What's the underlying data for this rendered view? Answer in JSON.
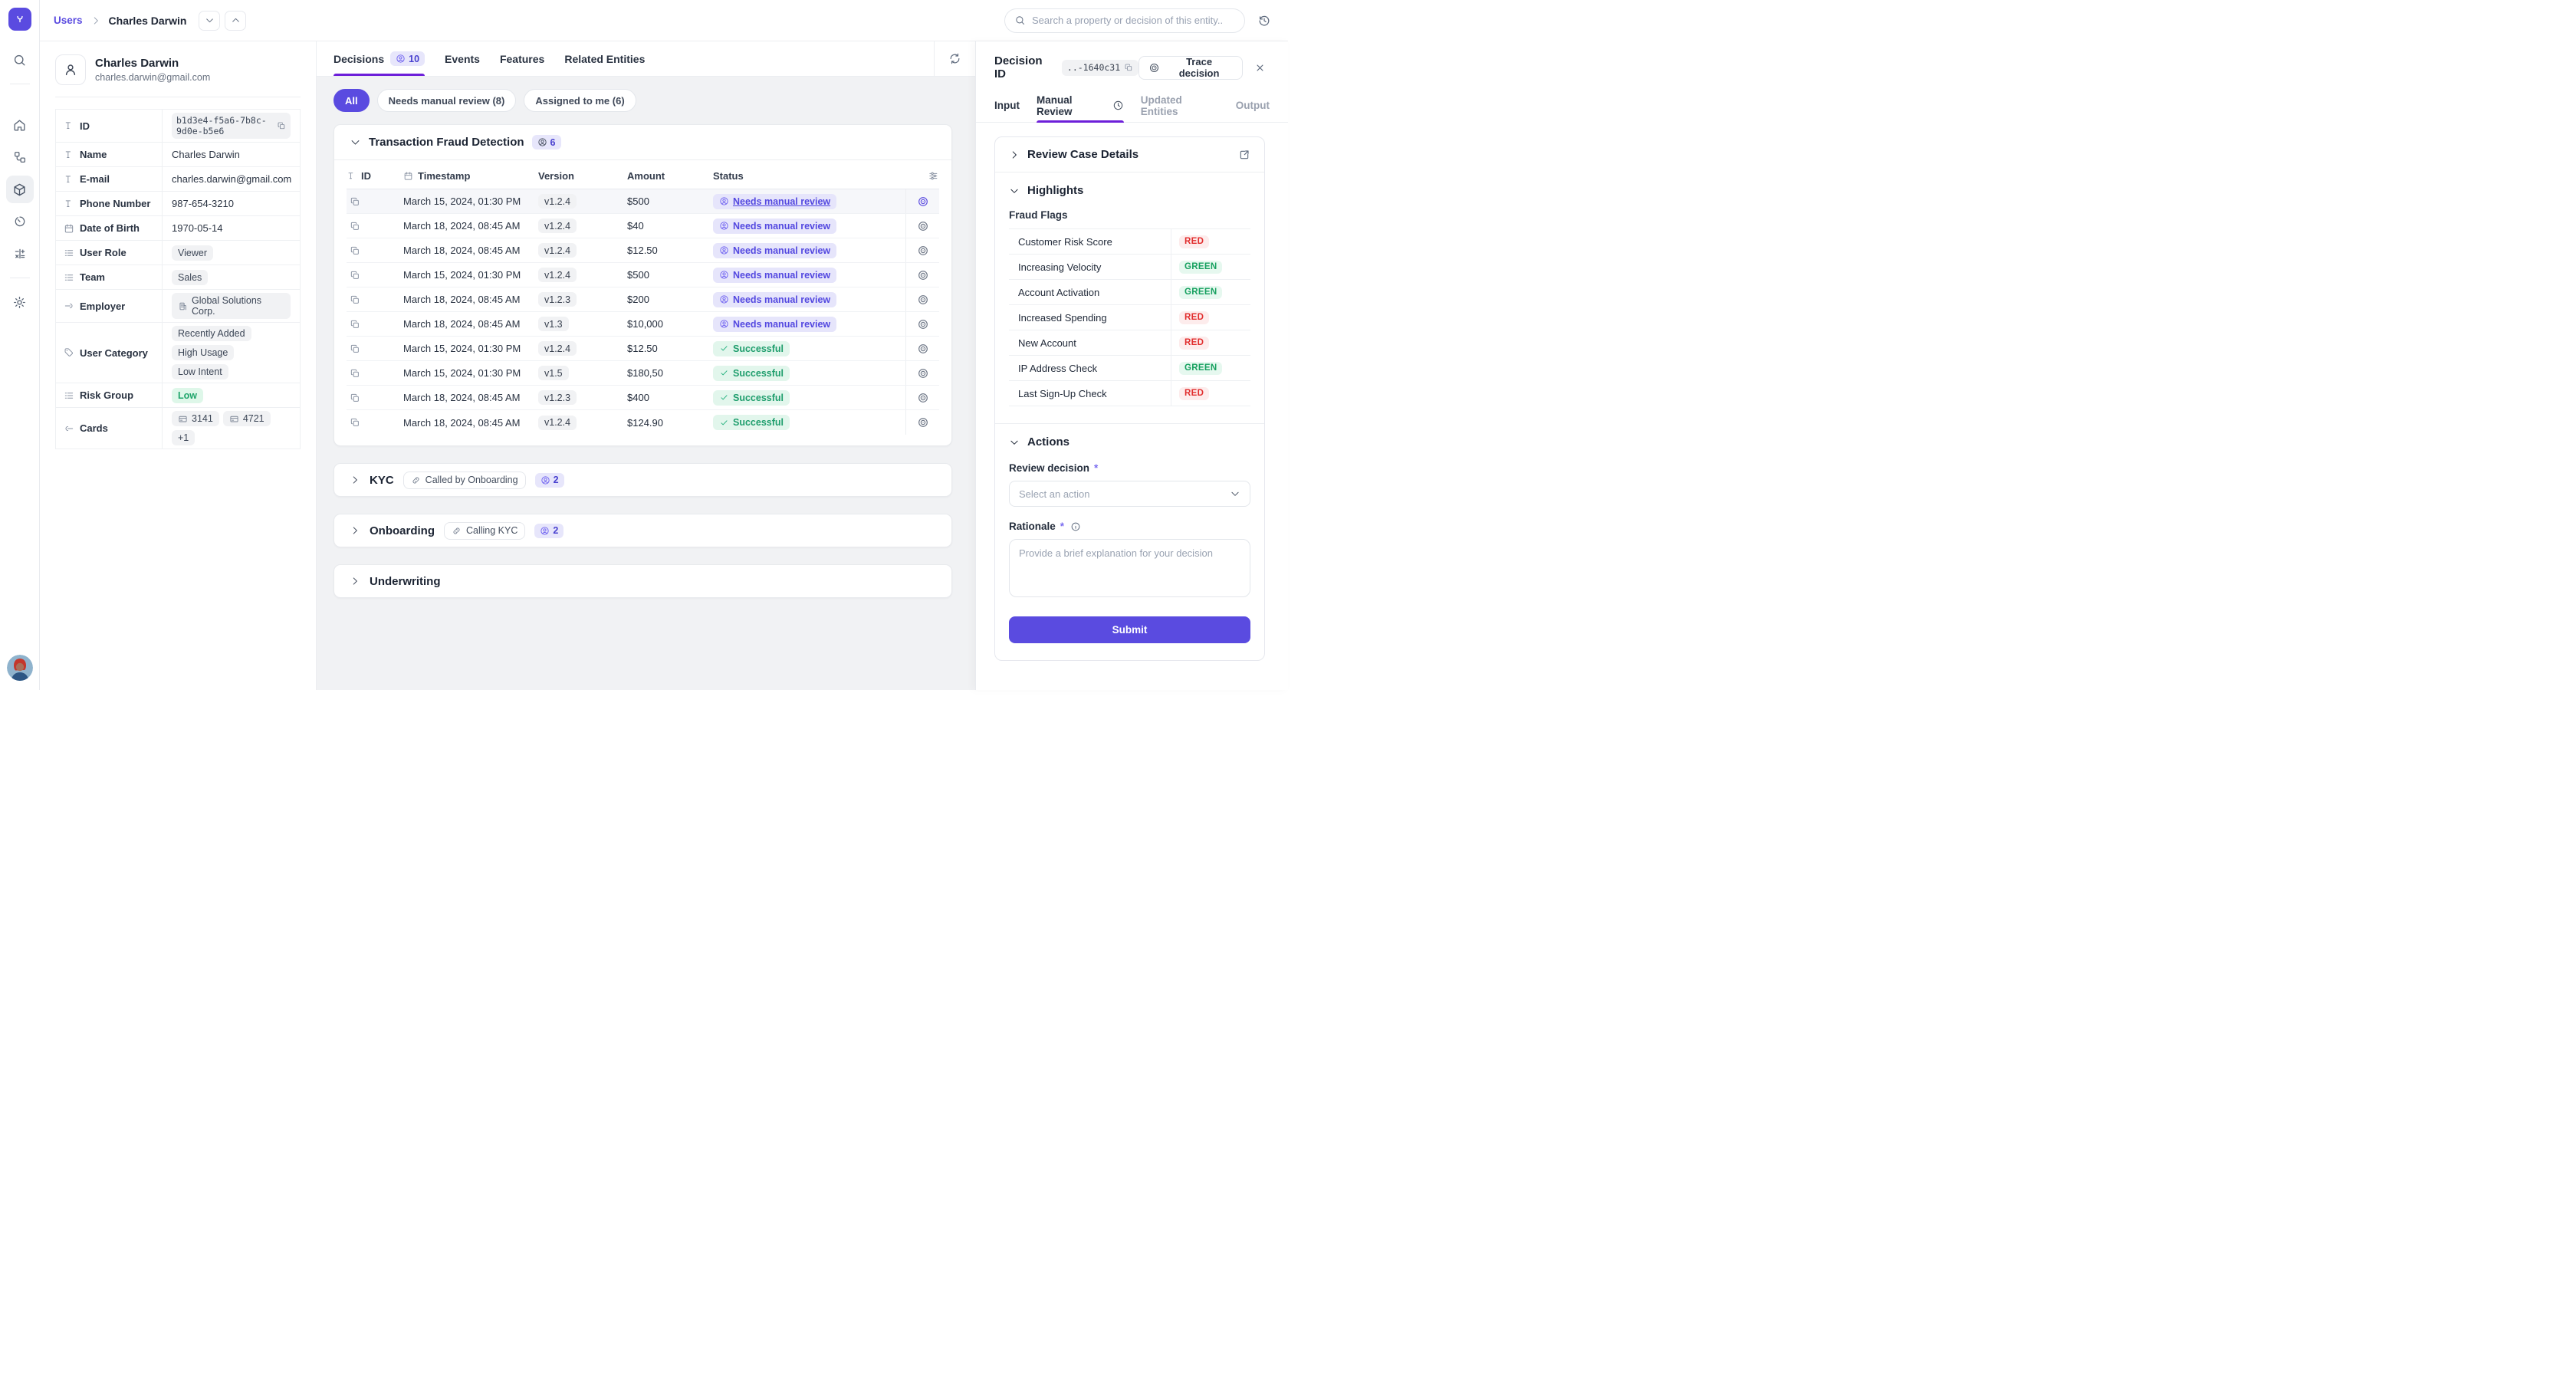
{
  "colors": {
    "accent": "#5a4be0",
    "underline": "#6d1fd9",
    "red": "#e12d2d",
    "red_bg": "#fdecec",
    "green": "#17a05f",
    "green_bg": "#e6f8ef"
  },
  "header": {
    "breadcrumb": {
      "root": "Users",
      "current": "Charles Darwin"
    },
    "search_placeholder": "Search a property or decision of this entity.."
  },
  "rail_items": [
    "search",
    "home",
    "workflow",
    "entities",
    "history-gauge",
    "calculator",
    "settings"
  ],
  "profile": {
    "name": "Charles Darwin",
    "email": "charles.darwin@gmail.com",
    "fields": [
      {
        "icon": "text",
        "label": "ID",
        "type": "code",
        "value": "b1d3e4-f5a6-7b8c-9d0e-b5e6"
      },
      {
        "icon": "text",
        "label": "Name",
        "type": "text",
        "value": "Charles Darwin"
      },
      {
        "icon": "text",
        "label": "E-mail",
        "type": "text",
        "value": "charles.darwin@gmail.com"
      },
      {
        "icon": "text",
        "label": "Phone Number",
        "type": "text",
        "value": "987-654-3210"
      },
      {
        "icon": "calendar",
        "label": "Date of Birth",
        "type": "text",
        "value": "1970-05-14"
      },
      {
        "icon": "list",
        "label": "User Role",
        "type": "chip",
        "value": "Viewer"
      },
      {
        "icon": "list",
        "label": "Team",
        "type": "chip",
        "value": "Sales"
      },
      {
        "icon": "rel-out",
        "label": "Employer",
        "type": "entity",
        "value": "Global Solutions Corp."
      },
      {
        "icon": "tag",
        "label": "User Category",
        "type": "chips",
        "values": [
          "Recently Added",
          "High Usage",
          "Low Intent"
        ]
      },
      {
        "icon": "list",
        "label": "Risk Group",
        "type": "chip-green",
        "value": "Low"
      },
      {
        "icon": "rel-in",
        "label": "Cards",
        "type": "cards",
        "values": [
          "3141",
          "4721"
        ],
        "more": "+1"
      }
    ]
  },
  "tabs": [
    {
      "label": "Decisions",
      "badge": "10",
      "active": true
    },
    {
      "label": "Events"
    },
    {
      "label": "Features"
    },
    {
      "label": "Related Entities"
    }
  ],
  "filters": [
    {
      "label": "All",
      "active": true
    },
    {
      "label": "Needs manual review (8)"
    },
    {
      "label": "Assigned to me (6)"
    }
  ],
  "decisions": {
    "transaction": {
      "title": "Transaction Fraud Detection",
      "badge": "6",
      "columns": [
        "ID",
        "Timestamp",
        "Version",
        "Amount",
        "Status"
      ],
      "rows": [
        {
          "timestamp": "March 15, 2024, 01:30 PM",
          "version": "v1.2.4",
          "amount": "$500",
          "status": "Needs manual review",
          "status_kind": "manual",
          "selected": true
        },
        {
          "timestamp": "March 18, 2024, 08:45 AM",
          "version": "v1.2.4",
          "amount": "$40",
          "status": "Needs manual review",
          "status_kind": "manual"
        },
        {
          "timestamp": "March 18, 2024, 08:45 AM",
          "version": "v1.2.4",
          "amount": "$12.50",
          "status": "Needs manual review",
          "status_kind": "manual"
        },
        {
          "timestamp": "March 15, 2024, 01:30 PM",
          "version": "v1.2.4",
          "amount": "$500",
          "status": "Needs manual review",
          "status_kind": "manual"
        },
        {
          "timestamp": "March 18, 2024, 08:45 AM",
          "version": "v1.2.3",
          "amount": "$200",
          "status": "Needs manual review",
          "status_kind": "manual"
        },
        {
          "timestamp": "March 18, 2024, 08:45 AM",
          "version": "v1.3",
          "amount": "$10,000",
          "status": "Needs manual review",
          "status_kind": "manual"
        },
        {
          "timestamp": "March 15, 2024, 01:30 PM",
          "version": "v1.2.4",
          "amount": "$12.50",
          "status": "Successful",
          "status_kind": "success"
        },
        {
          "timestamp": "March 15, 2024, 01:30 PM",
          "version": "v1.5",
          "amount": "$180,50",
          "status": "Successful",
          "status_kind": "success"
        },
        {
          "timestamp": "March 18, 2024, 08:45 AM",
          "version": "v1.2.3",
          "amount": "$400",
          "status": "Successful",
          "status_kind": "success"
        },
        {
          "timestamp": "March 18, 2024, 08:45 AM",
          "version": "v1.2.4",
          "amount": "$124.90",
          "status": "Successful",
          "status_kind": "success"
        }
      ]
    },
    "other_sections": [
      {
        "title": "KYC",
        "link": "Called by Onboarding",
        "badge": "2"
      },
      {
        "title": "Onboarding",
        "link": "Calling KYC",
        "badge": "2"
      },
      {
        "title": "Underwriting"
      }
    ]
  },
  "drawer": {
    "title": "Decision ID",
    "id_chip": "..-1640c31",
    "trace_label": "Trace decision",
    "tabs": [
      {
        "label": "Input"
      },
      {
        "label": "Manual Review",
        "icon": "clock",
        "active": true
      },
      {
        "label": "Updated Entities",
        "dim": true
      },
      {
        "label": "Output",
        "dim": true
      }
    ],
    "review_case_details": "Review Case Details",
    "highlights": {
      "title": "Highlights",
      "subtitle": "Fraud Flags",
      "flags": [
        {
          "name": "Customer Risk Score",
          "value": "RED"
        },
        {
          "name": "Increasing Velocity",
          "value": "GREEN"
        },
        {
          "name": "Account Activation",
          "value": "GREEN"
        },
        {
          "name": "Increased Spending",
          "value": "RED"
        },
        {
          "name": "New Account",
          "value": "RED"
        },
        {
          "name": "IP Address Check",
          "value": "GREEN"
        },
        {
          "name": "Last Sign-Up Check",
          "value": "RED"
        }
      ]
    },
    "actions": {
      "title": "Actions",
      "review_decision_label": "Review decision",
      "select_placeholder": "Select an action",
      "rationale_label": "Rationale",
      "rationale_placeholder": "Provide a brief explanation for your decision",
      "submit_label": "Submit"
    }
  }
}
